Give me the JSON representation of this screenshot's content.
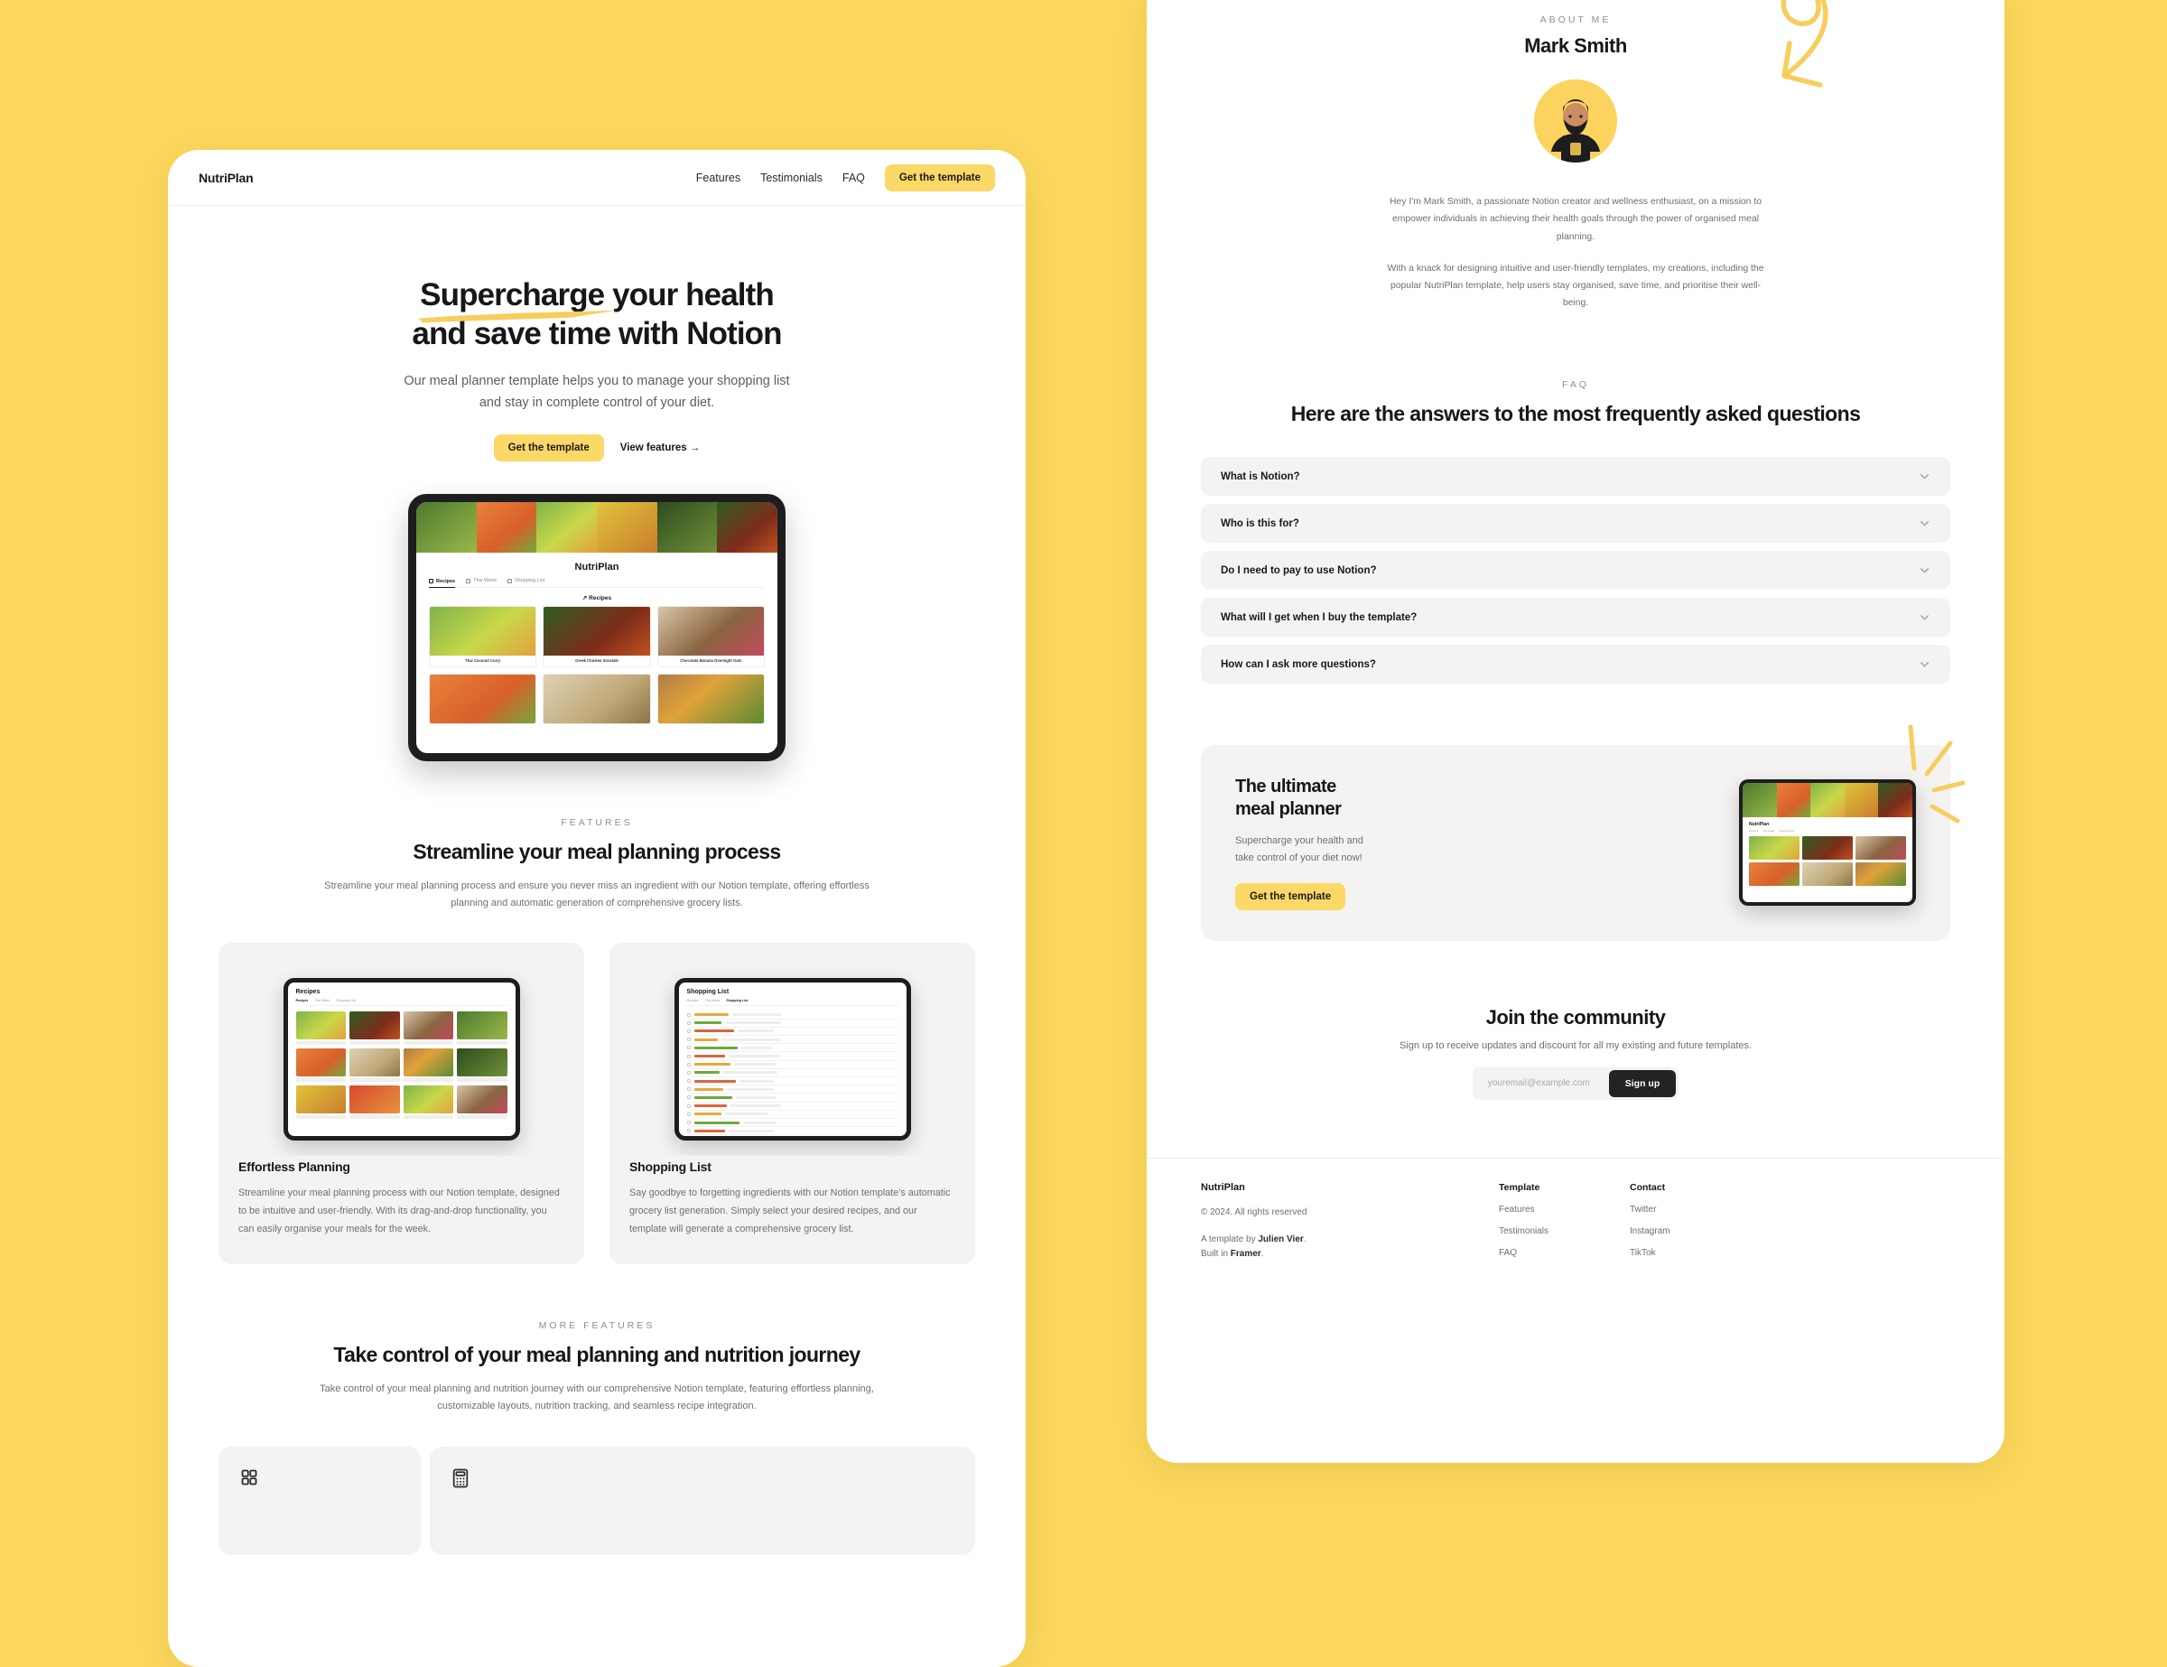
{
  "theme": {
    "background": "#FCD75B",
    "accent": "#FCD867",
    "ink": "#17171a",
    "muted": "#6e6e75",
    "card": "#F4F3F1"
  },
  "left_page": {
    "navbar": {
      "brand": "NutriPlan",
      "links": [
        {
          "label": "Features"
        },
        {
          "label": "Testimonials"
        },
        {
          "label": "FAQ"
        }
      ],
      "cta": "Get the template"
    },
    "hero": {
      "title_line1_a": "Supercharge",
      "title_line1_b": " your health",
      "title_line2": "and save time with Notion",
      "subtitle_line1": "Our meal planner template helps you to manage your shopping list",
      "subtitle_line2": "and stay in complete control of your diet.",
      "primary_cta": "Get the template",
      "secondary_cta": "View features →"
    },
    "mockup": {
      "app_title": "NutriPlan",
      "tabs": [
        {
          "label": "Recipes"
        },
        {
          "label": "This Week"
        },
        {
          "label": "Shopping List"
        }
      ],
      "section_label": "↗ Recipes",
      "recipes": [
        {
          "name": "Thai Coconut Curry"
        },
        {
          "name": "Greek Chicken Souvlaki"
        },
        {
          "name": "Chocolate Banana Overnight Oats"
        }
      ]
    },
    "features": {
      "eyebrow": "FEATURES",
      "heading": "Streamline your meal planning process",
      "description": "Streamline your meal planning process and ensure you never miss an ingredient with our Notion template, offering effortless planning and automatic generation of comprehensive grocery lists.",
      "cards": [
        {
          "title": "Effortless Planning",
          "body": "Streamline your meal planning process with our Notion template, designed to be intuitive and user-friendly. With its drag-and-drop functionality, you can easily organise your meals for the week.",
          "mock_title": "Recipes",
          "mock_tabs": [
            "Recipes",
            "This Week",
            "Shopping List"
          ]
        },
        {
          "title": "Shopping List",
          "body": "Say goodbye to forgetting ingredients with our Notion template's automatic grocery list generation. Simply select your desired recipes, and our template will generate a comprehensive grocery list.",
          "mock_title": "Shopping List",
          "mock_tabs": [
            "Recipes",
            "This Week",
            "Shopping List"
          ]
        }
      ]
    },
    "more_features": {
      "eyebrow": "MORE FEATURES",
      "heading": "Take control of your meal planning and nutrition journey",
      "description": "Take control of your meal planning and nutrition journey with our comprehensive Notion template, featuring effortless planning, customizable layouts, nutrition tracking, and seamless recipe integration.",
      "icon_cards": [
        {
          "icon": "grid-layout-icon"
        },
        {
          "icon": "calculator-icon"
        }
      ]
    }
  },
  "right_page": {
    "about": {
      "eyebrow": "ABOUT ME",
      "name": "Mark Smith",
      "avatar": "author-avatar",
      "paragraph1": "Hey I'm Mark Smith, a passionate Notion creator and wellness enthusiast, on a mission to empower individuals in achieving their health goals through the power of organised meal planning.",
      "paragraph2": "With a knack for designing intuitive and user-friendly templates, my creations, including the popular NutriPlan template, help users stay organised, save time, and prioritise their well-being."
    },
    "faq": {
      "eyebrow": "FAQ",
      "heading": "Here are the answers to the most frequently asked questions",
      "items": [
        {
          "question": "What is Notion?"
        },
        {
          "question": "Who is this for?"
        },
        {
          "question": "Do I need to pay to use Notion?"
        },
        {
          "question": "What will I get when I buy the template?"
        },
        {
          "question": "How can I ask more questions?"
        }
      ]
    },
    "cta_banner": {
      "title_line1": "The ultimate",
      "title_line2": "meal planner",
      "subtitle_line1": "Supercharge your health and",
      "subtitle_line2": "take control of your diet now!",
      "button": "Get the template",
      "mock_title": "NutriPlan",
      "mock_tabs": [
        "Recipes",
        "This Week",
        "Shopping List"
      ]
    },
    "community": {
      "heading": "Join the community",
      "subtitle": "Sign up to receive updates and discount for all my existing and future templates.",
      "email_placeholder": "youremail@example.com",
      "email_value": "",
      "button": "Sign up"
    },
    "footer": {
      "brand": "NutriPlan",
      "copyright": "© 2024. All rights reserved",
      "credit_prefix": "A template by ",
      "credit_author": "Julien Vier",
      "credit_suffix": ".",
      "built_prefix": "Built in ",
      "built_name": "Framer",
      "built_suffix": ".",
      "columns": [
        {
          "title": "Template",
          "links": [
            {
              "label": "Features"
            },
            {
              "label": "Testimonials"
            },
            {
              "label": "FAQ"
            }
          ]
        },
        {
          "title": "Contact",
          "links": [
            {
              "label": "Twitter"
            },
            {
              "label": "Instagram"
            },
            {
              "label": "TikTok"
            }
          ]
        }
      ]
    }
  }
}
